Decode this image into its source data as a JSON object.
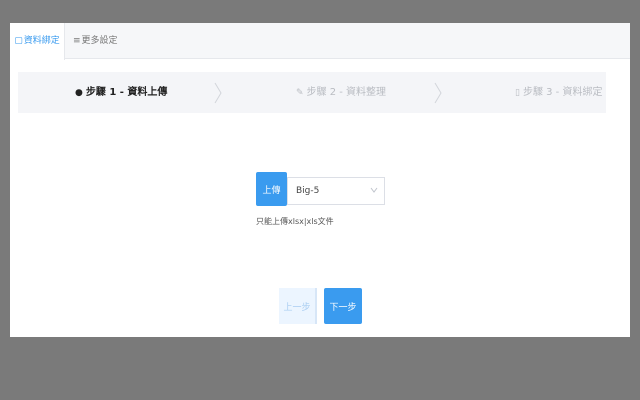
{
  "tabs": [
    {
      "icon": "data-binding-icon",
      "label": "資料綁定",
      "active": true
    },
    {
      "icon": "more-settings-icon",
      "label": "更多設定",
      "active": false
    }
  ],
  "steps": [
    {
      "icon": "fire-icon",
      "label": "步驟 1 - 資料上傳",
      "state": "active"
    },
    {
      "icon": "edit-icon",
      "label": "步驟 2 - 資料整理",
      "state": "pending"
    },
    {
      "icon": "clipboard-icon",
      "label": "步驟 3 - 資料綁定",
      "state": "pending"
    }
  ],
  "upload": {
    "button_label": "上傳",
    "encoding_value": "Big-5",
    "hint": "只能上傳xlsx|xls文件"
  },
  "nav": {
    "prev_label": "上一步",
    "next_label": "下一步"
  },
  "colors": {
    "accent": "#3a9bef",
    "backdrop": "#7a7a7a"
  }
}
